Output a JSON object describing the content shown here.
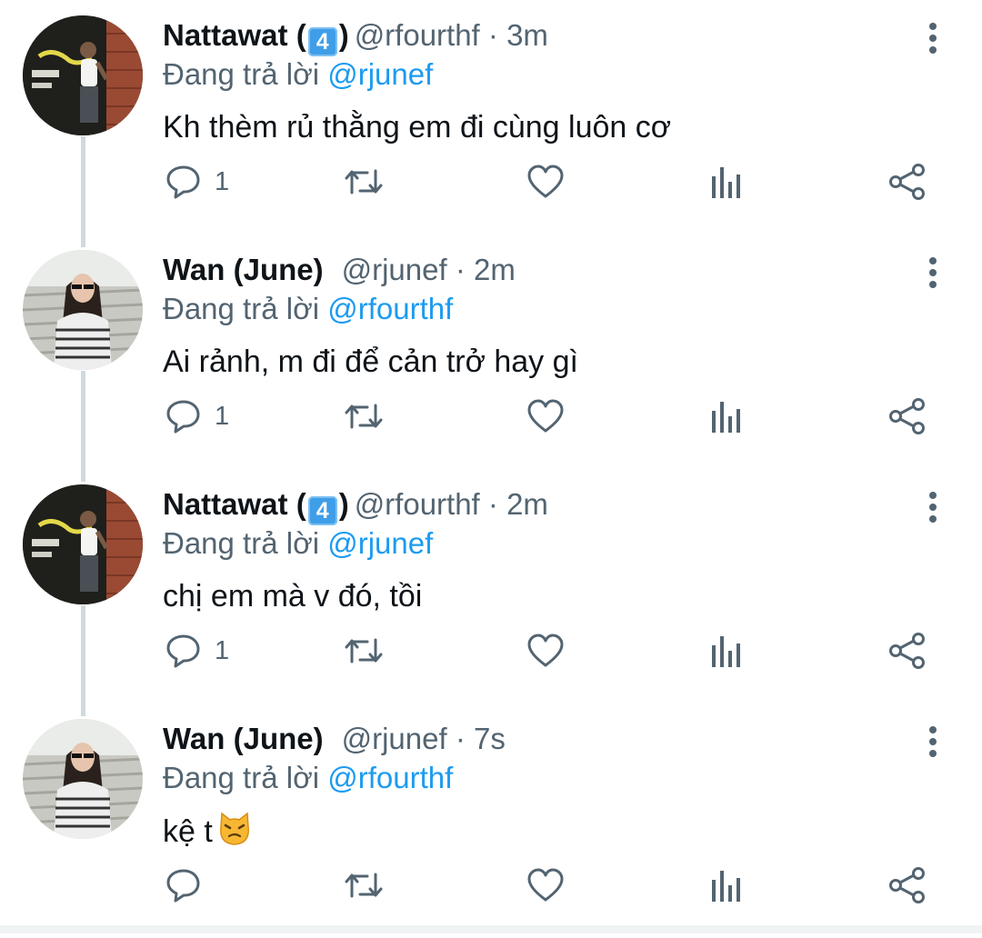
{
  "tweets": [
    {
      "name": "Nattawat (",
      "badge": "4",
      "name_end": ")",
      "handle": "@rfourthf",
      "separator": "·",
      "time": "3m",
      "reply_prefix": "Đang trả lời",
      "reply_to": "@rjunef",
      "text": "Kh thèm rủ thằng em đi cùng luôn cơ",
      "reply_count": "1",
      "avatar": "avatar-nattawat"
    },
    {
      "name": "Wan (June)",
      "handle": "@rjunef",
      "separator": "·",
      "time": "2m",
      "reply_prefix": "Đang trả lời",
      "reply_to": "@rfourthf",
      "text": "Ai rảnh, m đi để cản trở hay gì",
      "reply_count": "1",
      "avatar": "avatar-wan"
    },
    {
      "name": "Nattawat (",
      "badge": "4",
      "name_end": ")",
      "handle": "@rfourthf",
      "separator": "·",
      "time": "2m",
      "reply_prefix": "Đang trả lời",
      "reply_to": "@rjunef",
      "text": "chị em mà v đó, tồi",
      "reply_count": "1",
      "avatar": "avatar-nattawat"
    },
    {
      "name": "Wan (June)",
      "handle": "@rjunef",
      "separator": "·",
      "time": "7s",
      "reply_prefix": "Đang trả lời",
      "reply_to": "@rfourthf",
      "text": "kệ t",
      "text_emoji": "cat-face-emoji",
      "reply_count": "",
      "avatar": "avatar-wan"
    }
  ],
  "icons": {
    "reply": "reply-icon",
    "retweet": "retweet-icon",
    "like": "heart-icon",
    "views": "analytics-icon",
    "share": "share-icon",
    "more": "more-vertical-icon"
  },
  "colors": {
    "text": "#0f1419",
    "secondary": "#536471",
    "mention": "#1d9bf0",
    "thread_line": "#cfd9de",
    "badge": "#3f9ee8"
  }
}
